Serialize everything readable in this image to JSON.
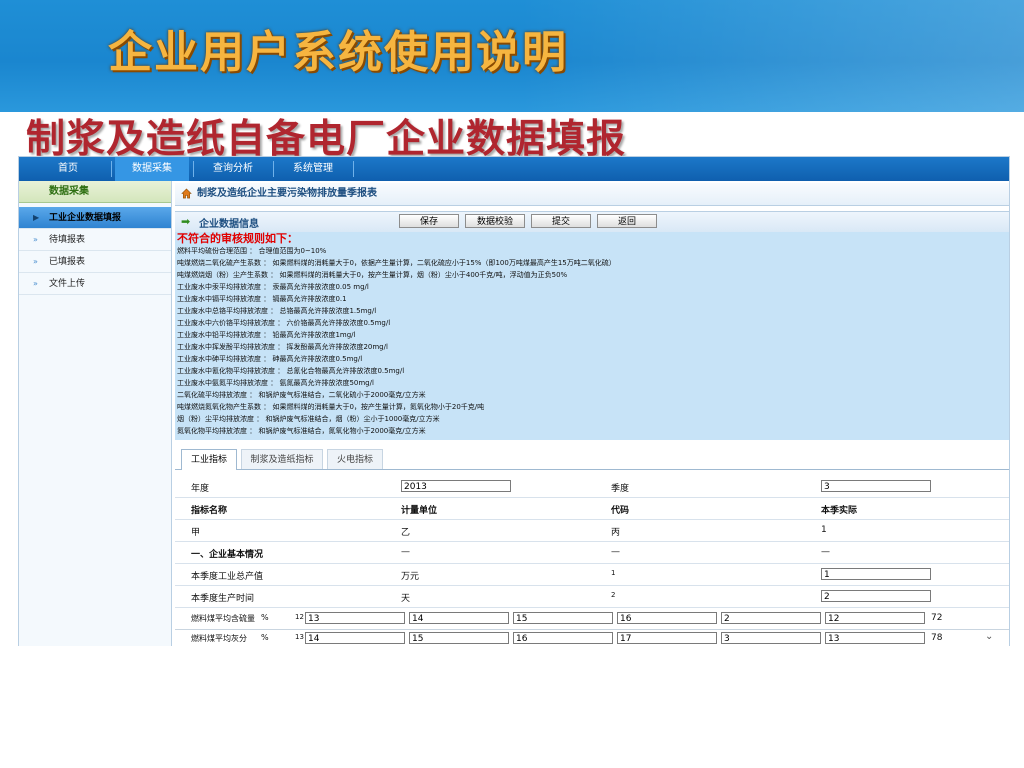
{
  "slide": {
    "title": "企业用户系统使用说明",
    "subtitle": "制浆及造纸自备电厂企业数据填报"
  },
  "nav": {
    "items": [
      "首页",
      "数据采集",
      "查询分析",
      "系统管理"
    ]
  },
  "sidebar": {
    "header": "数据采集",
    "items": [
      "工业企业数据填报",
      "待填报表",
      "已填报表",
      "文件上传"
    ]
  },
  "breadcrumb": "制浆及造纸企业主要污染物排放量季报表",
  "info": {
    "label": "企业数据信息",
    "buttons": {
      "save": "保存",
      "verify": "数据校验",
      "submit": "提交",
      "back": "返回"
    }
  },
  "rules": {
    "title": "不符合的审核规则如下：",
    "lines": [
      "燃料平均硫份合理范围 ： 合理值范围为0~10%",
      "吨煤燃烧二氧化硫产生系数 ： 如果燃料煤的消耗量大于0，依据产生量计算，二氧化硫应小于15%（即100万吨煤最高产生15万吨二氧化硫）",
      "吨煤燃烧烟（粉）尘产生系数 ： 如果燃料煤的消耗量大于0，按产生量计算，烟（粉）尘小于400千克/吨，浮动值为正负50%",
      "工业废水中汞平均排放浓度 ： 汞最高允许排放浓度0.05 mg/l",
      "工业废水中镉平均排放浓度 ： 镉最高允许排放浓度0.1",
      "工业废水中总铬平均排放浓度 ： 总铬最高允许排放浓度1.5mg/l",
      "工业废水中六价铬平均排放浓度 ： 六价铬最高允许排放浓度0.5mg/l",
      "工业废水中铅平均排放浓度 ： 铅最高允许排放浓度1mg/l",
      "工业废水中挥发酚平均排放浓度 ： 挥发酚最高允许排放浓度20mg/l",
      "工业废水中砷平均排放浓度 ： 砷最高允许排放浓度0.5mg/l",
      "工业废水中氰化物平均排放浓度 ： 总氰化合物最高允许排放浓度0.5mg/l",
      "工业废水中氨氮平均排放浓度 ： 氨氮最高允许排放浓度50mg/l",
      "二氧化硫平均排放浓度 ： 和锅炉废气标准结合，二氧化硫小于2000毫克/立方米",
      "吨煤燃烧氮氧化物产生系数 ： 如果燃料煤的消耗量大于0，按产生量计算，氮氧化物小于20千克/吨",
      "烟（粉）尘平均排放浓度 ： 和锅炉废气标准结合，烟（粉）尘小于1000毫克/立方米",
      "氮氧化物平均排放浓度 ： 和锅炉废气标准结合，氮氧化物小于2000毫克/立方米"
    ]
  },
  "tabs": [
    "工业指标",
    "制浆及造纸指标",
    "火电指标"
  ],
  "table": {
    "year_label": "年度",
    "year_value": "2013",
    "quarter_label": "季度",
    "quarter_value": "3",
    "headers": [
      "指标名称",
      "计量单位",
      "代码",
      "本季实际"
    ],
    "code_row": [
      "甲",
      "乙",
      "丙",
      "1"
    ],
    "section": [
      "一、企业基本情况",
      "—",
      "—",
      "—"
    ],
    "rows": [
      {
        "name": "本季度工业总产值",
        "unit": "万元",
        "code": "1",
        "value": "1"
      },
      {
        "name": "本季度生产时间",
        "unit": "天",
        "code": "2",
        "value": "2"
      }
    ],
    "mini_rows": [
      {
        "name": "燃料煤平均含硫量",
        "unit": "%",
        "code": "12",
        "vals": [
          "13",
          "14",
          "15",
          "16",
          "2",
          "12",
          "72"
        ]
      },
      {
        "name": "燃料煤平均灰分",
        "unit": "%",
        "code": "13",
        "vals": [
          "14",
          "15",
          "16",
          "17",
          "3",
          "13",
          "78"
        ]
      }
    ]
  }
}
